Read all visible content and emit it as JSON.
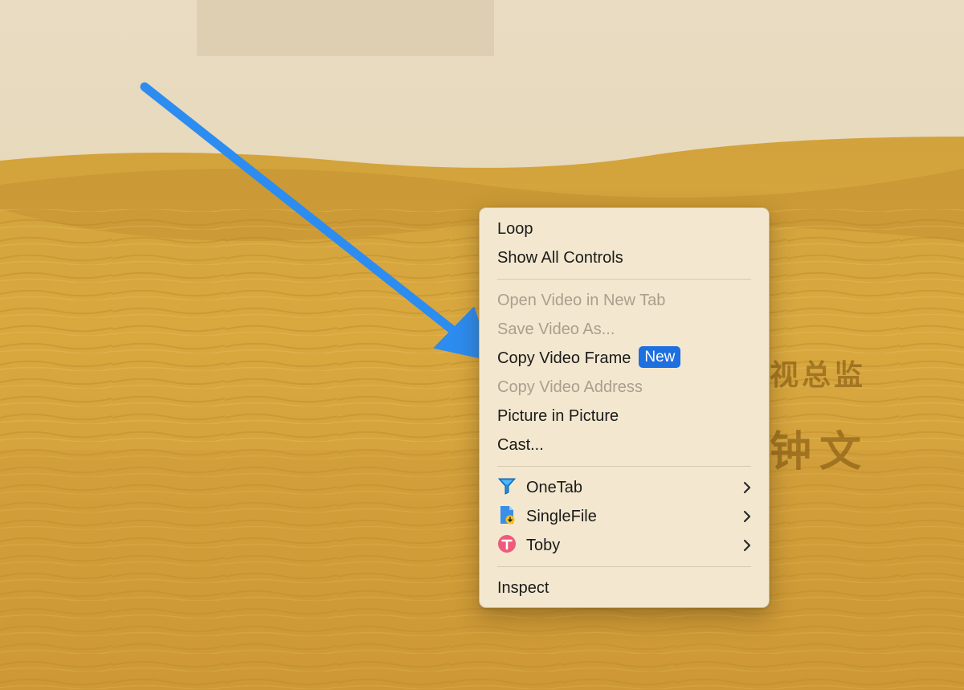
{
  "video": {
    "subtitle_line_1": "视总监",
    "subtitle_line_2": "钟文"
  },
  "annotation": {
    "arrow_color": "#2d8cf0",
    "icon": "arrow-annotation-icon"
  },
  "context_menu": {
    "loop": "Loop",
    "show_all_controls": "Show All Controls",
    "open_video_new_tab": "Open Video in New Tab",
    "save_video_as": "Save Video As...",
    "copy_video_frame": "Copy Video Frame",
    "new_badge": "New",
    "copy_video_address": "Copy Video Address",
    "picture_in_picture": "Picture in Picture",
    "cast": "Cast...",
    "extensions": [
      {
        "label": "OneTab",
        "icon": "onetab-funnel-icon"
      },
      {
        "label": "SingleFile",
        "icon": "singlefile-document-icon"
      },
      {
        "label": "Toby",
        "icon": "toby-circle-icon"
      }
    ],
    "inspect": "Inspect",
    "badge_color": "#1e6fe0"
  }
}
